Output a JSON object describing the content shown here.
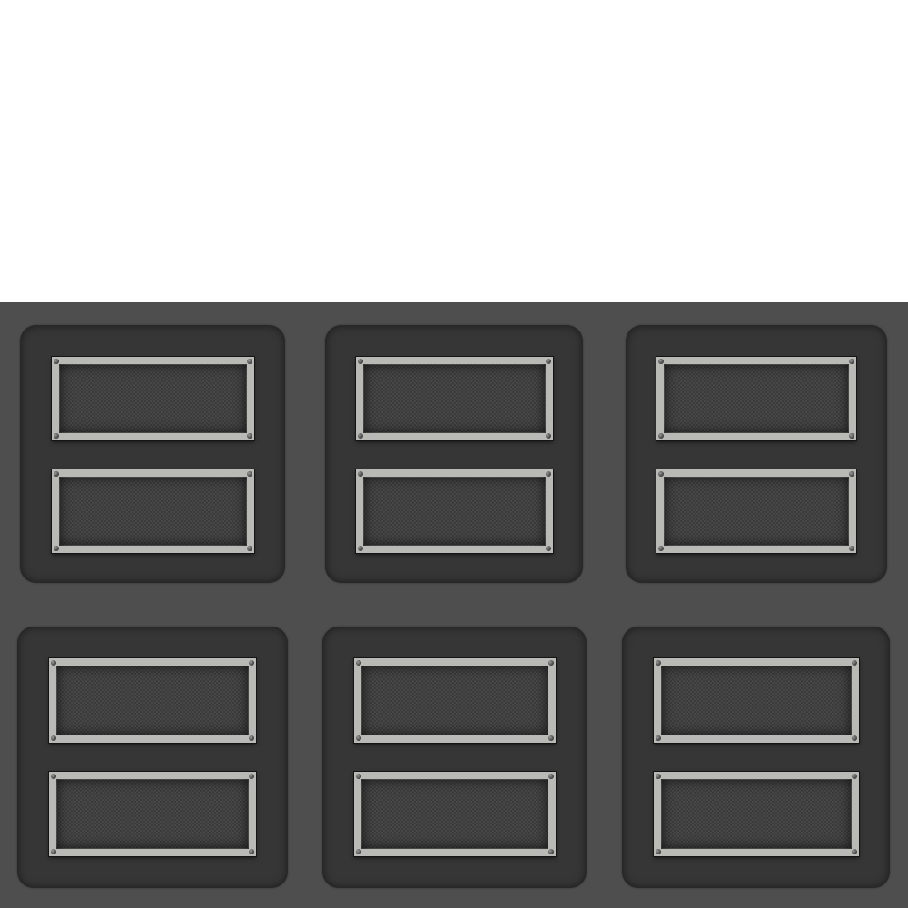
{
  "scene": {
    "background_top": "#ffffff",
    "board_color": "#4e4e4e",
    "panel_color": "#363636",
    "frame_color": "#b9b9b6",
    "mesh_color": "#474747"
  },
  "panels": [
    {
      "name": "panel-row1-col1",
      "slots": 2
    },
    {
      "name": "panel-row1-col2",
      "slots": 2
    },
    {
      "name": "panel-row1-col3",
      "slots": 2
    },
    {
      "name": "panel-row2-col1",
      "slots": 2
    },
    {
      "name": "panel-row2-col2",
      "slots": 2
    },
    {
      "name": "panel-row2-col3",
      "slots": 2
    }
  ]
}
